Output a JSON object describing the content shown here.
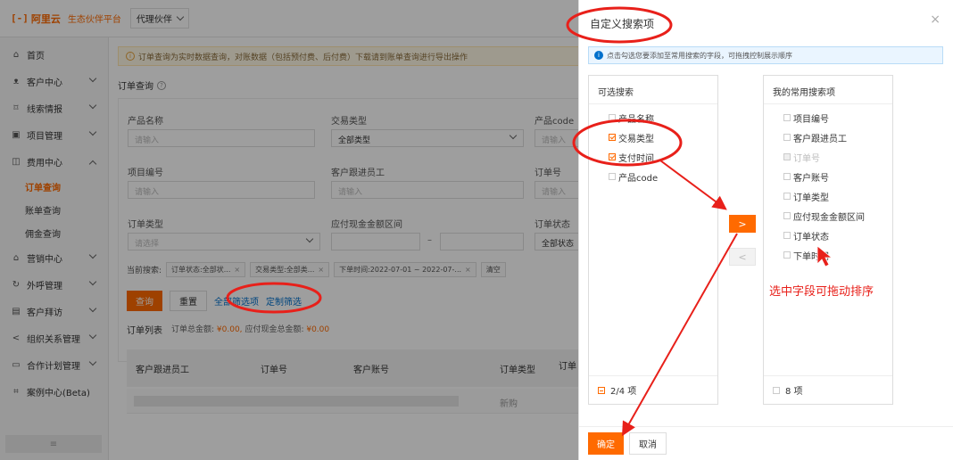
{
  "topbar": {
    "logo_mark": "[-]",
    "logo_text": "阿里云",
    "logo_sub": "生态伙伴平台",
    "partner_select": "代理伙伴"
  },
  "sidebar": {
    "items": [
      {
        "icon": "⌂",
        "label": "首页"
      },
      {
        "icon": "ᴥ",
        "label": "客户中心"
      },
      {
        "icon": "⌑",
        "label": "线索情报"
      },
      {
        "icon": "▣",
        "label": "项目管理"
      },
      {
        "icon": "◫",
        "label": "费用中心"
      }
    ],
    "subitems": [
      "订单查询",
      "账单查询",
      "佣金查询"
    ],
    "items2": [
      {
        "icon": "⌂",
        "label": "营销中心"
      },
      {
        "icon": "↻",
        "label": "外呼管理"
      },
      {
        "icon": "▤",
        "label": "客户拜访"
      },
      {
        "icon": "<",
        "label": "组织关系管理"
      },
      {
        "icon": "▭",
        "label": "合作计划管理"
      },
      {
        "icon": "⌗",
        "label": "案例中心(Beta)"
      }
    ],
    "footer": "≡"
  },
  "main": {
    "alert": "订单查询为实时数据查询，对账数据（包括预付费、后付费）下载请到账单查询进行导出操作",
    "section_title": "订单查询",
    "fields": {
      "product_name": {
        "label": "产品名称",
        "placeholder": "请输入"
      },
      "trade_type": {
        "label": "交易类型",
        "value": "全部类型"
      },
      "product_code": {
        "label": "产品code",
        "placeholder": "请输入"
      },
      "project_no": {
        "label": "项目编号",
        "placeholder": "请输入"
      },
      "follow_staff": {
        "label": "客户跟进员工",
        "placeholder": "请输入"
      },
      "order_no": {
        "label": "订单号",
        "placeholder": "请输入"
      },
      "order_type": {
        "label": "订单类型",
        "placeholder": "请选择"
      },
      "amount_range": {
        "label": "应付现金金额区间",
        "sep": "–"
      },
      "order_status": {
        "label": "订单状态",
        "value": "全部状态"
      }
    },
    "current_search_label": "当前搜索:",
    "tags": [
      "订单状态:全部状...",
      "交易类型:全部类...",
      "下单时间:2022-07-01 ~ 2022-07-..."
    ],
    "clear_label": "清空",
    "query_btn": "查询",
    "reset_btn": "重置",
    "link_all_filters": "全部筛选项",
    "link_custom_filter": "定制筛选",
    "list_title": "订单列表",
    "total_label": "订单总金额:",
    "total_value": "¥0.00,",
    "payable_label": "应付现金总金额:",
    "payable_value": "¥0.00",
    "table_headers": [
      "客户跟进员工",
      "订单号",
      "客户账号",
      "订单类型",
      "订单"
    ],
    "row_type": "新购"
  },
  "drawer": {
    "title": "自定义搜索项",
    "close": "×",
    "info": "点击勾选您要添加至常用搜索的字段，可拖拽控制展示顺序",
    "left_panel": {
      "title": "可选搜索",
      "options": [
        {
          "label": "产品名称",
          "state": "unchecked"
        },
        {
          "label": "交易类型",
          "state": "checked"
        },
        {
          "label": "支付时间",
          "state": "checked"
        },
        {
          "label": "产品code",
          "state": "unchecked"
        }
      ],
      "footer": "2/4 项"
    },
    "right_panel": {
      "title": "我的常用搜索项",
      "options": [
        {
          "label": "项目编号",
          "state": "unchecked"
        },
        {
          "label": "客户跟进员工",
          "state": "unchecked"
        },
        {
          "label": "订单号",
          "state": "disabled"
        },
        {
          "label": "客户账号",
          "state": "unchecked"
        },
        {
          "label": "订单类型",
          "state": "unchecked"
        },
        {
          "label": "应付现金金额区间",
          "state": "unchecked"
        },
        {
          "label": "订单状态",
          "state": "unchecked"
        },
        {
          "label": "下单时间",
          "state": "unchecked"
        }
      ],
      "footer": "8 项"
    },
    "move_right": ">",
    "move_left": "<",
    "ok_btn": "确定",
    "cancel_btn": "取消"
  },
  "annotation": "选中字段可拖动排序",
  "colors": {
    "accent": "#ff6a00",
    "annotation": "#e8201a",
    "link": "#0070cc"
  }
}
